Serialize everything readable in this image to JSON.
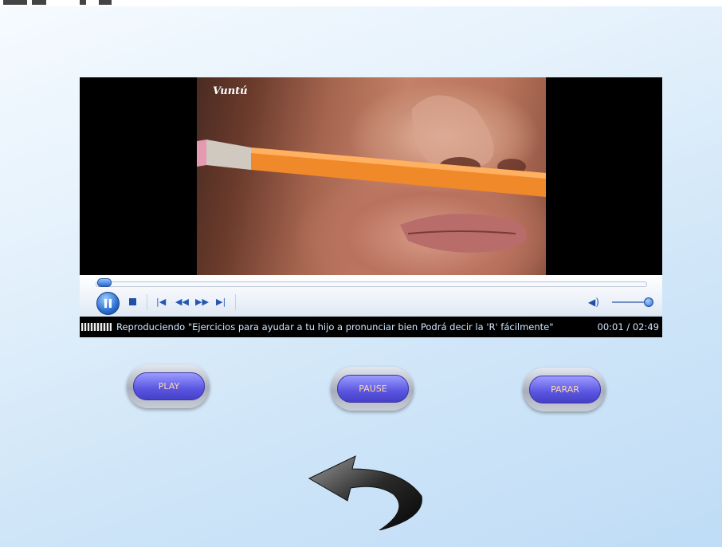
{
  "video": {
    "watermark": "Vuntú",
    "status_text": "Reproduciendo \"Ejercicios para ayudar a tu hijo a pronunciar bien Podrá decir la 'R' fácilmente\"",
    "time": "00:01 / 02:49",
    "progress": 0.006,
    "volume": 1.0
  },
  "buttons": {
    "play": "PLAY",
    "pause": "PAUSE",
    "stop": "PARAR"
  },
  "icons": [
    "play-pause-icon",
    "stop-icon",
    "previous-icon",
    "rewind-icon",
    "fast-forward-icon",
    "next-icon",
    "volume-icon",
    "back-arrow-icon"
  ]
}
